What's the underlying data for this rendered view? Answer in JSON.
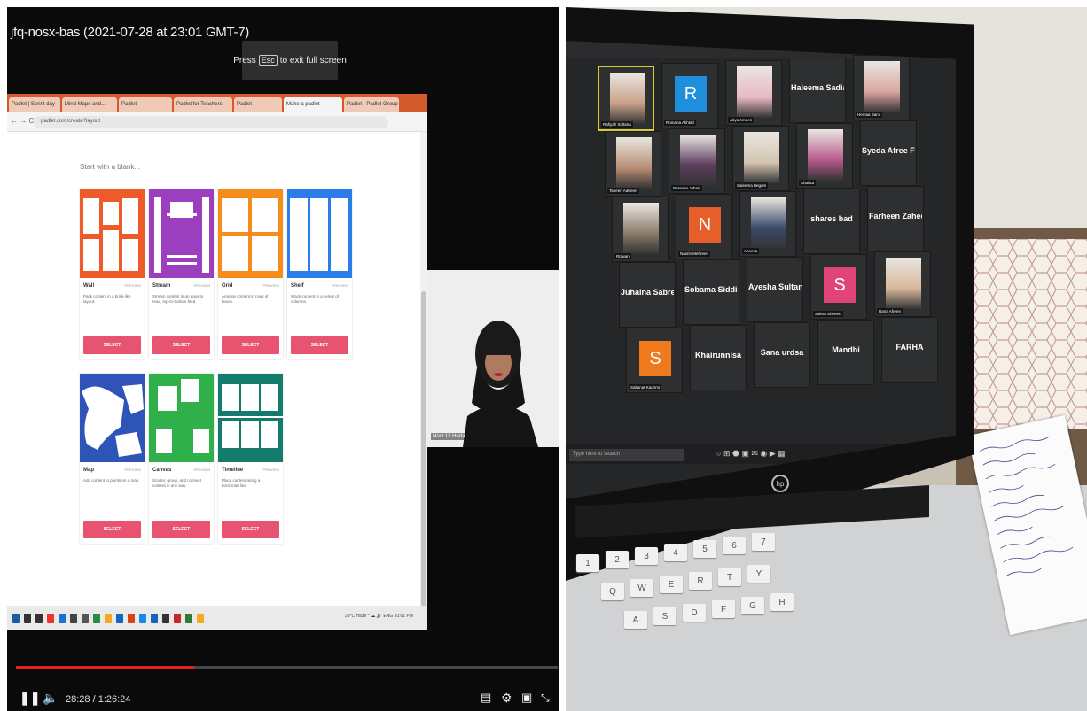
{
  "video": {
    "title": "jfq-nosx-bas (2021-07-28 at 23:01 GMT-7)",
    "esc_hint": {
      "before": "Press",
      "key": "Esc",
      "after": "to exit full screen"
    },
    "time_current": "28:28",
    "time_total": "1:26:24",
    "progress": 0.329
  },
  "browser": {
    "tabs": [
      "Padlet | Sprint day",
      "Mind Maps and...",
      "Padlet",
      "Padlet for Teachers",
      "Padlet",
      "Make a padlet",
      "Padlet - Padlet Group"
    ],
    "active_tab": 5,
    "address": "padlet.com/create?layout"
  },
  "padlet": {
    "start_label": "Start with a blank...",
    "preview_label": "PREVIEW",
    "button_label": "SELECT",
    "cards": [
      {
        "name": "Wall",
        "desc": "Pack content in a brick-like layout.",
        "color": "#ef5a2b"
      },
      {
        "name": "Stream",
        "desc": "Stream content in an easy to read, top-to-bottom feed.",
        "color": "#9b3fbf"
      },
      {
        "name": "Grid",
        "desc": "Arrange content in rows of boxes.",
        "color": "#f58c1c"
      },
      {
        "name": "Shelf",
        "desc": "Stack content in a series of columns.",
        "color": "#2b7de9"
      },
      {
        "name": "Map",
        "desc": "Add content to points on a map.",
        "color": "#2e54b8"
      },
      {
        "name": "Canvas",
        "desc": "Scatter, group, and connect content in any way.",
        "color": "#2fb04a"
      },
      {
        "name": "Timeline",
        "desc": "Place content along a horizontal line.",
        "color": "#137b6c"
      }
    ]
  },
  "windows_taskbar": {
    "tray": "29°C Haze ^ ☁ 🔊 ENG  10:01 PM"
  },
  "presenter": {
    "name": "Noor Ul Huda"
  },
  "zoom": {
    "tiles": [
      {
        "label": "Rafiyah Sultana",
        "kind": "video",
        "active": true
      },
      {
        "label": "Romana Akhtari",
        "kind": "letter",
        "letter": "R",
        "bg": "#1f8fdc"
      },
      {
        "label": "Atiya Ameen",
        "kind": "video"
      },
      {
        "label": "",
        "kind": "text",
        "text": "Haleema Sadia"
      },
      {
        "label": "Hemaa Bano",
        "kind": "video"
      },
      {
        "label": "Tabeen Aafreen",
        "kind": "video"
      },
      {
        "label": "Nasreen Jahan",
        "kind": "video"
      },
      {
        "label": "Saleema Begum",
        "kind": "video"
      },
      {
        "label": "Shaista",
        "kind": "video"
      },
      {
        "label": "",
        "kind": "text",
        "text": "Syeda Afree Fat..."
      },
      {
        "label": "Rizwan",
        "kind": "video"
      },
      {
        "label": "Nasrin Mehreen",
        "kind": "letter",
        "letter": "N",
        "bg": "#e65f2b"
      },
      {
        "label": "Aneesa",
        "kind": "video"
      },
      {
        "label": "",
        "kind": "text",
        "text": "shares bad"
      },
      {
        "label": "",
        "kind": "text",
        "text": "Farheen Zaheer"
      },
      {
        "label": "",
        "kind": "text",
        "text": "Juhaina Sabreen"
      },
      {
        "label": "",
        "kind": "text",
        "text": "Sobama Siddiqui"
      },
      {
        "label": "",
        "kind": "text",
        "text": "Ayesha Sultana"
      },
      {
        "label": "Salma Shireen",
        "kind": "letter",
        "letter": "S",
        "bg": "#e04579"
      },
      {
        "label": "Rana Afreen",
        "kind": "video"
      },
      {
        "label": "Saltanat Kadirmi",
        "kind": "letter",
        "letter": "S",
        "bg": "#ef7a1e"
      },
      {
        "label": "",
        "kind": "text",
        "text": "Khairunnisa"
      },
      {
        "label": "",
        "kind": "text",
        "text": "Sana urdsa"
      },
      {
        "label": "",
        "kind": "text",
        "text": "Mandhi"
      },
      {
        "label": "",
        "kind": "text",
        "text": "FARHA"
      }
    ],
    "search_placeholder": "Type here to search"
  },
  "laptop": {
    "brand": "hp",
    "keys": [
      "1",
      "2",
      "3",
      "4",
      "5",
      "6",
      "7",
      "Q",
      "W",
      "E",
      "R",
      "T",
      "Y",
      "A",
      "S",
      "D",
      "F",
      "G",
      "H"
    ]
  }
}
